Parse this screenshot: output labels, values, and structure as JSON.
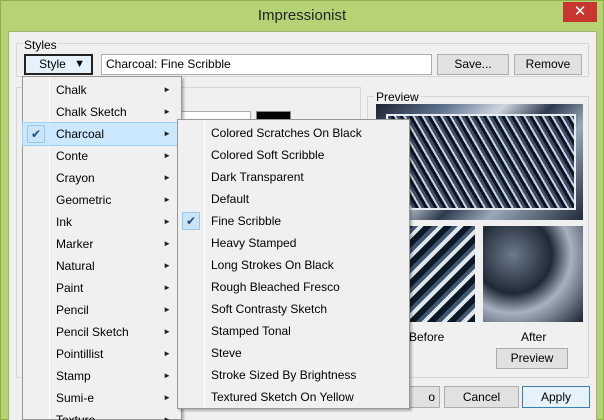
{
  "window": {
    "title": "Impressionist",
    "close_glyph": "✕"
  },
  "styles": {
    "group_label": "Styles",
    "style_button": "Style",
    "style_button_arrow": "▼",
    "current_style": "Charcoal: Fine Scribble",
    "save_label": "Save...",
    "remove_label": "Remove"
  },
  "preview": {
    "group_label": "Preview",
    "before_label": "Before",
    "after_label": "After",
    "preview_button": "Preview"
  },
  "footer": {
    "ok_label": "o",
    "cancel_label": "Cancel",
    "apply_label": "Apply"
  },
  "style_menu": {
    "checked_item": "Charcoal",
    "items": [
      "Chalk",
      "Chalk Sketch",
      "Charcoal",
      "Conte",
      "Crayon",
      "Geometric",
      "Ink",
      "Marker",
      "Natural",
      "Paint",
      "Pencil",
      "Pencil Sketch",
      "Pointillist",
      "Stamp",
      "Sumi-e",
      "Texture"
    ]
  },
  "charcoal_submenu": {
    "checked_item": "Fine Scribble",
    "items": [
      "Colored Scratches On Black",
      "Colored Soft Scribble",
      "Dark Transparent",
      "Default",
      "Fine Scribble",
      "Heavy Stamped",
      "Long Strokes On Black",
      "Rough Bleached Fresco",
      "Soft Contrasty Sketch",
      "Stamped Tonal",
      "Steve",
      "Stroke Sized By Brightness",
      "Textured Sketch On Yellow"
    ]
  },
  "icons": {
    "submenu_arrow": "►",
    "check": "✔"
  },
  "colors": {
    "accent": "#cce8ff",
    "titlebar": "#b5d374",
    "close": "#c7372f",
    "apply_border": "#3c7fb1"
  }
}
